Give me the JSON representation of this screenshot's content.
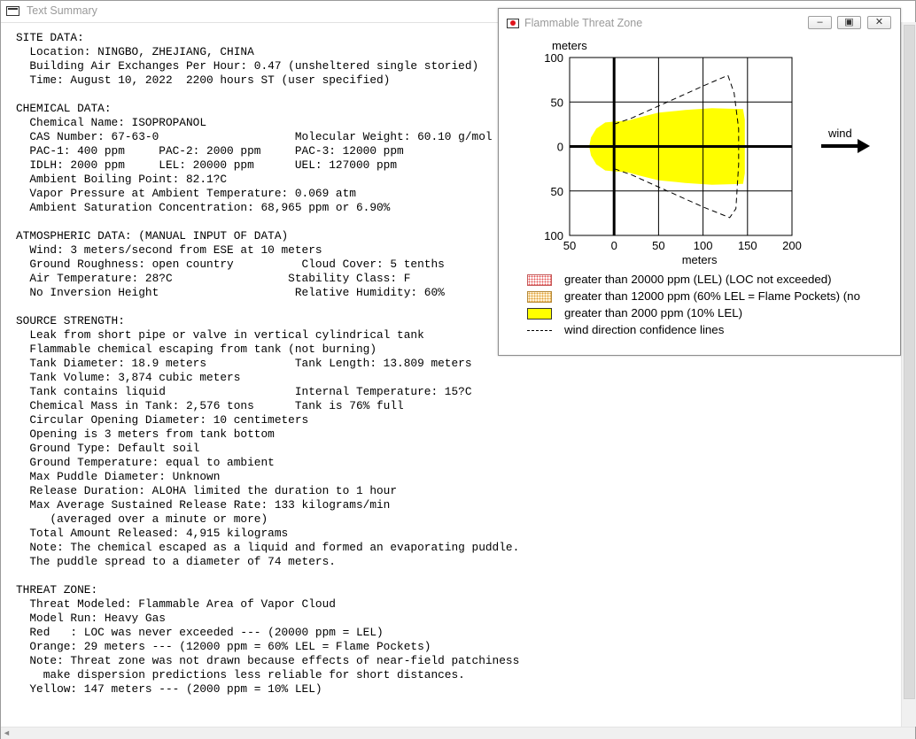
{
  "main_window": {
    "title": "Text Summary"
  },
  "summary": {
    "lines": [
      "SITE DATA:",
      "  Location: NINGBO, ZHEJIANG, CHINA",
      "  Building Air Exchanges Per Hour: 0.47 (unsheltered single storied)",
      "  Time: August 10, 2022  2200 hours ST (user specified)",
      "",
      "CHEMICAL DATA:",
      "  Chemical Name: ISOPROPANOL",
      "  CAS Number: 67-63-0                    Molecular Weight: 60.10 g/mol",
      "  PAC-1: 400 ppm     PAC-2: 2000 ppm     PAC-3: 12000 ppm",
      "  IDLH: 2000 ppm     LEL: 20000 ppm      UEL: 127000 ppm",
      "  Ambient Boiling Point: 82.1?C",
      "  Vapor Pressure at Ambient Temperature: 0.069 atm",
      "  Ambient Saturation Concentration: 68,965 ppm or 6.90%",
      "",
      "ATMOSPHERIC DATA: (MANUAL INPUT OF DATA)",
      "  Wind: 3 meters/second from ESE at 10 meters",
      "  Ground Roughness: open country          Cloud Cover: 5 tenths",
      "  Air Temperature: 28?C                 Stability Class: F",
      "  No Inversion Height                    Relative Humidity: 60%",
      "",
      "SOURCE STRENGTH:",
      "  Leak from short pipe or valve in vertical cylindrical tank",
      "  Flammable chemical escaping from tank (not burning)",
      "  Tank Diameter: 18.9 meters             Tank Length: 13.809 meters",
      "  Tank Volume: 3,874 cubic meters",
      "  Tank contains liquid                   Internal Temperature: 15?C",
      "  Chemical Mass in Tank: 2,576 tons      Tank is 76% full",
      "  Circular Opening Diameter: 10 centimeters",
      "  Opening is 3 meters from tank bottom",
      "  Ground Type: Default soil",
      "  Ground Temperature: equal to ambient",
      "  Max Puddle Diameter: Unknown",
      "  Release Duration: ALOHA limited the duration to 1 hour",
      "  Max Average Sustained Release Rate: 133 kilograms/min",
      "     (averaged over a minute or more)",
      "  Total Amount Released: 4,915 kilograms",
      "  Note: The chemical escaped as a liquid and formed an evaporating puddle.",
      "  The puddle spread to a diameter of 74 meters.",
      "",
      "THREAT ZONE:",
      "  Threat Modeled: Flammable Area of Vapor Cloud",
      "  Model Run: Heavy Gas",
      "  Red   : LOC was never exceeded --- (20000 ppm = LEL)",
      "  Orange: 29 meters --- (12000 ppm = 60% LEL = Flame Pockets)",
      "  Note: Threat zone was not drawn because effects of near-field patchiness",
      "    make dispersion predictions less reliable for short distances.",
      "  Yellow: 147 meters --- (2000 ppm = 10% LEL)"
    ]
  },
  "threat_window": {
    "title": "Flammable Threat Zone",
    "buttons": {
      "minimize": "–",
      "maximize": "▣",
      "close": "✕"
    },
    "wind_label": "wind",
    "legend": [
      {
        "swatch": "red-dotted",
        "label": "greater than 20000 ppm (LEL) (LOC not exceeded)"
      },
      {
        "swatch": "orange-dotted",
        "label": "greater than 12000 ppm (60% LEL = Flame Pockets) (no"
      },
      {
        "swatch": "yellow",
        "label": "greater than 2000 ppm (10% LEL)"
      },
      {
        "swatch": "dashed-line",
        "label": "wind direction confidence lines"
      }
    ]
  },
  "chart_data": {
    "type": "area",
    "xlabel": "meters",
    "ylabel": "meters",
    "xlim": [
      -50,
      200
    ],
    "ylim": [
      -100,
      100
    ],
    "x_ticks": [
      -50,
      0,
      50,
      100,
      150,
      200
    ],
    "x_tick_labels": [
      "50",
      "0",
      "50",
      "100",
      "150",
      "200"
    ],
    "y_ticks": [
      100,
      50,
      0,
      -50,
      -100
    ],
    "y_tick_labels": [
      "100",
      "50",
      "0",
      "50",
      "100"
    ],
    "grid": true,
    "colors": {
      "yellow_zone": "#ffff00",
      "grid": "#000000"
    },
    "yellow_zone": {
      "name": "greater than 2000 ppm (10% LEL)",
      "outline": [
        [
          -28,
          0
        ],
        [
          -26,
          10
        ],
        [
          -20,
          20
        ],
        [
          -10,
          27
        ],
        [
          0,
          28
        ],
        [
          15,
          29
        ],
        [
          30,
          33
        ],
        [
          50,
          38
        ],
        [
          80,
          41
        ],
        [
          110,
          43
        ],
        [
          145,
          42
        ],
        [
          147,
          30
        ],
        [
          147,
          0
        ],
        [
          147,
          -30
        ],
        [
          145,
          -42
        ],
        [
          110,
          -43
        ],
        [
          80,
          -41
        ],
        [
          50,
          -38
        ],
        [
          30,
          -33
        ],
        [
          15,
          -29
        ],
        [
          0,
          -28
        ],
        [
          -10,
          -27
        ],
        [
          -20,
          -20
        ],
        [
          -26,
          -10
        ]
      ]
    },
    "confidence_lines": [
      [
        [
          0,
          25
        ],
        [
          20,
          32
        ],
        [
          60,
          50
        ],
        [
          100,
          68
        ],
        [
          128,
          80
        ],
        [
          135,
          60
        ],
        [
          140,
          20
        ],
        [
          140,
          -20
        ],
        [
          137,
          -70
        ],
        [
          130,
          -80
        ],
        [
          100,
          -68
        ],
        [
          60,
          -50
        ],
        [
          20,
          -32
        ],
        [
          0,
          -25
        ]
      ]
    ],
    "wind_direction": "east"
  }
}
